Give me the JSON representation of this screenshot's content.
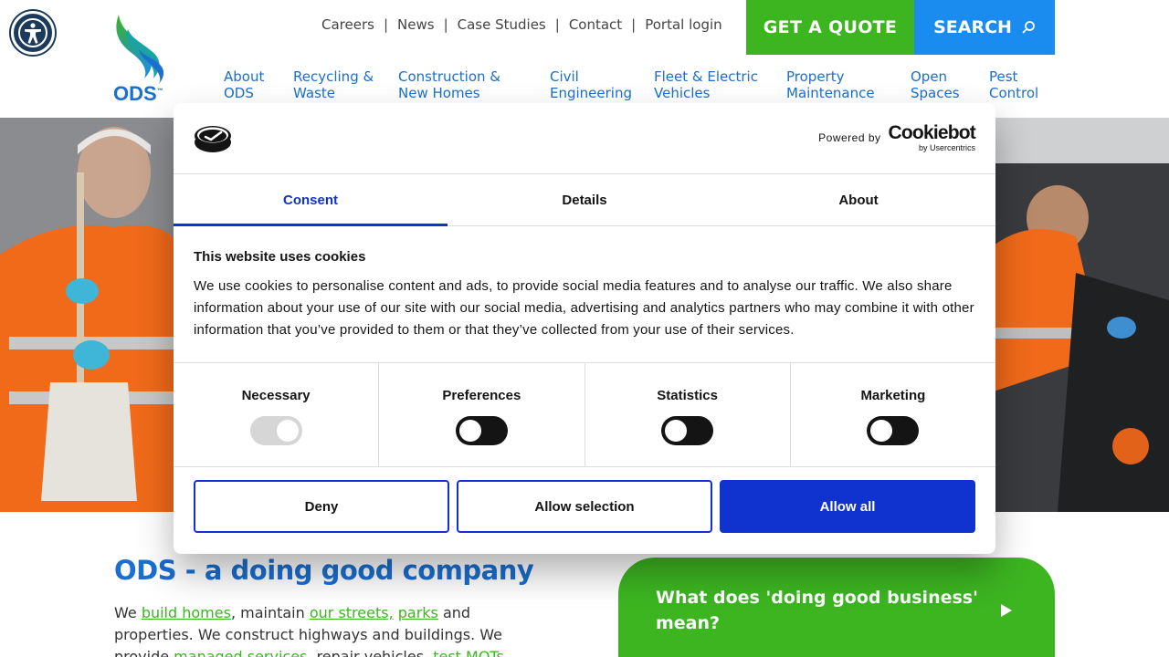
{
  "accessibility": {
    "icon": "accessibility-icon"
  },
  "logo": {
    "text": "ODS",
    "tm": "™"
  },
  "top_links": [
    "Careers",
    "News",
    "Case Studies",
    "Contact",
    "Portal login"
  ],
  "top_sep": "|",
  "buttons": {
    "quote": "GET A QUOTE",
    "search": "SEARCH"
  },
  "nav": [
    {
      "line1": "About",
      "line2": "ODS"
    },
    {
      "line1": "Recycling &",
      "line2": "Waste"
    },
    {
      "line1": "Construction &",
      "line2": "New Homes"
    },
    {
      "line1": "Civil",
      "line2": "Engineering"
    },
    {
      "line1": "Fleet & Electric",
      "line2": "Vehicles"
    },
    {
      "line1": "Property",
      "line2": "Maintenance"
    },
    {
      "line1": "Open",
      "line2": "Spaces"
    },
    {
      "line1": "Pest",
      "line2": "Control"
    }
  ],
  "intro": {
    "heading": "ODS - a doing good company",
    "p1": "We ",
    "l1": "build homes",
    "p2": ", maintain ",
    "l2": "our streets,",
    "p3": " ",
    "l3": "parks",
    "p4": " and properties. We construct highways and buildings. We provide ",
    "l4": "managed services",
    "p5": ", repair vehicles, ",
    "l5": "test MOTs"
  },
  "cta": {
    "text": "What does 'doing good business' mean?"
  },
  "cookie": {
    "powered_by": "Powered by",
    "brand": "Cookiebot",
    "brand_sub": "by Usercentrics",
    "tabs": [
      "Consent",
      "Details",
      "About"
    ],
    "title": "This website uses cookies",
    "description": "We use cookies to personalise content and ads, to provide social media features and to analyse our traffic. We also share information about your use of our site with our social media, advertising and analytics partners who may combine it with other information that you’ve provided to them or that they’ve collected from your use of their services.",
    "categories": [
      {
        "label": "Necessary",
        "on": true,
        "disabled": true
      },
      {
        "label": "Preferences",
        "on": false,
        "disabled": false
      },
      {
        "label": "Statistics",
        "on": false,
        "disabled": false
      },
      {
        "label": "Marketing",
        "on": false,
        "disabled": false
      }
    ],
    "buttons": {
      "deny": "Deny",
      "selection": "Allow selection",
      "all": "Allow all"
    }
  },
  "colors": {
    "green": "#3cb521",
    "blue": "#1a8cf0",
    "brand_blue": "#1a6fd0",
    "cookie_blue": "#1032cf"
  }
}
